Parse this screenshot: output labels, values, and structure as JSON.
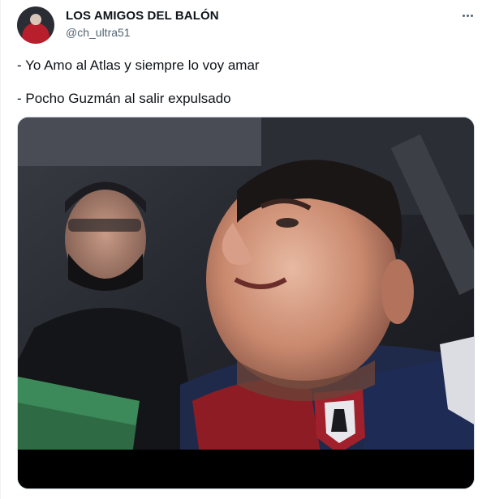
{
  "author": {
    "display_name": "LOS AMIGOS DEL BALÓN",
    "handle": "@ch_ultra51"
  },
  "icons": {
    "more": "more-horizontal-icon",
    "avatar": "profile-avatar"
  },
  "tweet": {
    "lines": [
      "- Yo Amo al Atlas y siempre lo voy amar",
      "- Pocho Guzmán al salir expulsado"
    ]
  },
  "media": {
    "type": "video-frame"
  },
  "colors": {
    "text_primary": "#0f1419",
    "text_secondary": "#536471",
    "border": "#cfd9de",
    "atlas_red": "#b81e2b"
  }
}
